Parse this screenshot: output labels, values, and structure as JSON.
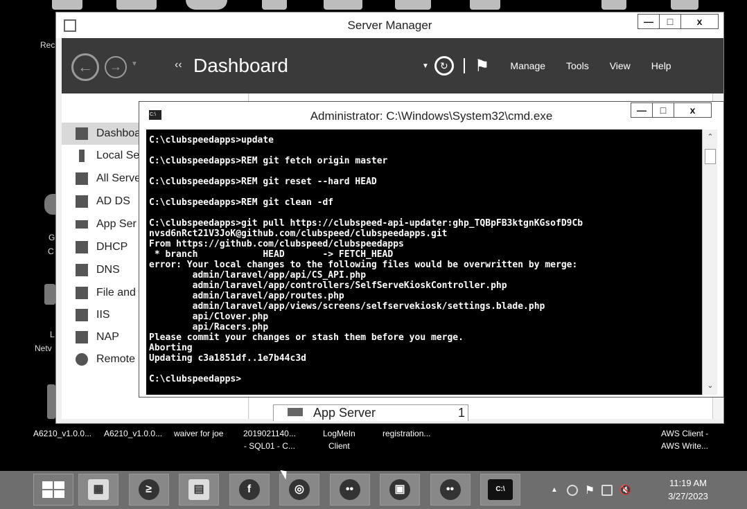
{
  "desktop": {
    "left_labels": [
      "Rec",
      "G",
      "C",
      "L",
      "Netv"
    ],
    "bottom_items": [
      {
        "line1": "A6210_v1.0.0...",
        "line2": ""
      },
      {
        "line1": "A6210_v1.0.0...",
        "line2": ""
      },
      {
        "line1": "waiver for joe",
        "line2": ""
      },
      {
        "line1": "2019021140...",
        "line2": "- SQL01 - C..."
      },
      {
        "line1": "LogMeIn",
        "line2": "Client"
      },
      {
        "line1": "registration...",
        "line2": ""
      },
      {
        "line1": "AWS Client -",
        "line2": "AWS Write..."
      }
    ]
  },
  "server_manager": {
    "title": "Server Manager",
    "header": {
      "arrows": "‹‹",
      "title": "Dashboard",
      "menu": [
        "Manage",
        "Tools",
        "View",
        "Help"
      ]
    },
    "sidebar": [
      {
        "label": "Dashboa",
        "icon": "dashboard-grid-icon"
      },
      {
        "label": "Local Se",
        "icon": "local-server-icon"
      },
      {
        "label": "All Serve",
        "icon": "all-servers-icon"
      },
      {
        "label": "AD DS",
        "icon": "ad-ds-icon"
      },
      {
        "label": "App Ser",
        "icon": "app-server-icon"
      },
      {
        "label": "DHCP",
        "icon": "dhcp-icon"
      },
      {
        "label": "DNS",
        "icon": "dns-icon"
      },
      {
        "label": "File and",
        "icon": "file-storage-icon"
      },
      {
        "label": "IIS",
        "icon": "iis-icon"
      },
      {
        "label": "NAP",
        "icon": "nap-icon"
      },
      {
        "label": "Remote",
        "icon": "remote-access-icon"
      }
    ],
    "tile": {
      "label": "App Server",
      "count": "1"
    }
  },
  "cmd": {
    "title": "Administrator: C:\\Windows\\System32\\cmd.exe",
    "lines": [
      {
        "text": "C:\\clubspeedapps>update",
        "gap": false
      },
      {
        "text": "C:\\clubspeedapps>REM git fetch origin master",
        "gap": true
      },
      {
        "text": "C:\\clubspeedapps>REM git reset --hard HEAD",
        "gap": true
      },
      {
        "text": "C:\\clubspeedapps>REM git clean -df",
        "gap": true
      },
      {
        "text": "C:\\clubspeedapps>git pull https://clubspeed-api-updater:ghp_TQBpFB3ktgnKGsofD9Cb",
        "gap": true
      },
      {
        "text": "nvsd6nRct21V3JoK@github.com/clubspeed/clubspeedapps.git",
        "gap": false
      },
      {
        "text": "From https://github.com/clubspeed/clubspeedapps",
        "gap": false
      },
      {
        "text": " * branch            HEAD       -> FETCH_HEAD",
        "gap": false
      },
      {
        "text": "error: Your local changes to the following files would be overwritten by merge:",
        "gap": false
      },
      {
        "text": "        admin/laravel/app/api/CS_API.php",
        "gap": false
      },
      {
        "text": "        admin/laravel/app/controllers/SelfServeKioskController.php",
        "gap": false
      },
      {
        "text": "        admin/laravel/app/routes.php",
        "gap": false
      },
      {
        "text": "        admin/laravel/app/views/screens/selfservekiosk/settings.blade.php",
        "gap": false
      },
      {
        "text": "        api/Clover.php",
        "gap": false
      },
      {
        "text": "        api/Racers.php",
        "gap": false
      },
      {
        "text": "Please commit your changes or stash them before you merge.",
        "gap": false
      },
      {
        "text": "Aborting",
        "gap": false
      },
      {
        "text": "Updating c3a1851df..1e7b44c3d",
        "gap": false
      },
      {
        "text": "C:\\clubspeedapps>",
        "gap": true
      }
    ]
  },
  "window_buttons": {
    "minimize": "—",
    "maximize": "□",
    "close": "x"
  },
  "taskbar": {
    "apps": [
      {
        "name": "server-manager-task",
        "glyph": "▦"
      },
      {
        "name": "powershell-task",
        "glyph": "≥"
      },
      {
        "name": "file-explorer-task",
        "glyph": "▤"
      },
      {
        "name": "app-f-task",
        "glyph": "f"
      },
      {
        "name": "chrome-task",
        "glyph": "◎"
      },
      {
        "name": "logmein-task",
        "glyph": "••"
      },
      {
        "name": "network-task",
        "glyph": "▣"
      },
      {
        "name": "logmein-client-task",
        "glyph": "••"
      },
      {
        "name": "cmd-task",
        "glyph": "C:\\"
      }
    ],
    "tray_arrow": "▲",
    "time": "11:19 AM",
    "date": "3/27/2023"
  }
}
